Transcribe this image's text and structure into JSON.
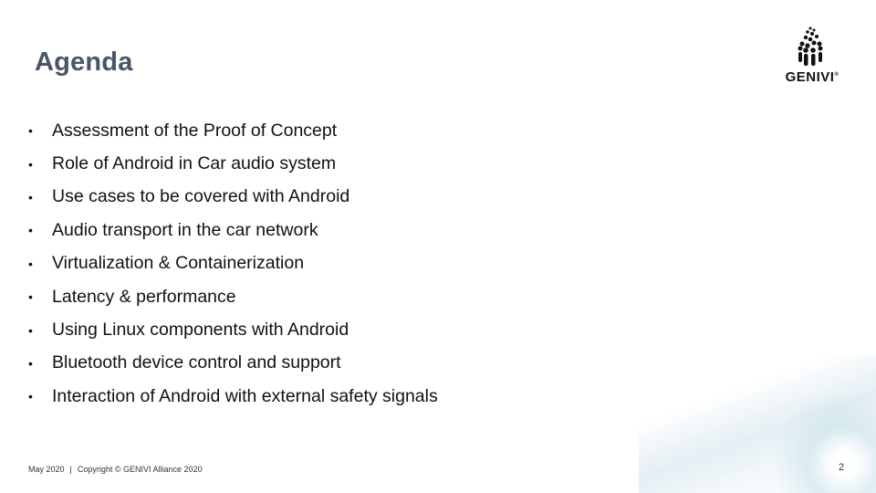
{
  "slide": {
    "title": "Agenda",
    "logo": {
      "text": "GENIVI",
      "mark": "®"
    },
    "items": [
      "Assessment of the Proof of Concept",
      "Role of Android in Car audio system",
      "Use cases to be covered with Android",
      "Audio transport in the car network",
      "Virtualization & Containerization",
      "Latency & performance",
      "Using Linux components with Android",
      "Bluetooth device control and support",
      "Interaction of Android with external safety signals"
    ],
    "bullet": "•",
    "footer": {
      "date": "May 2020",
      "separator": "|",
      "copyright": "Copyright © GENIVI Alliance 2020"
    },
    "page_number": "2"
  }
}
